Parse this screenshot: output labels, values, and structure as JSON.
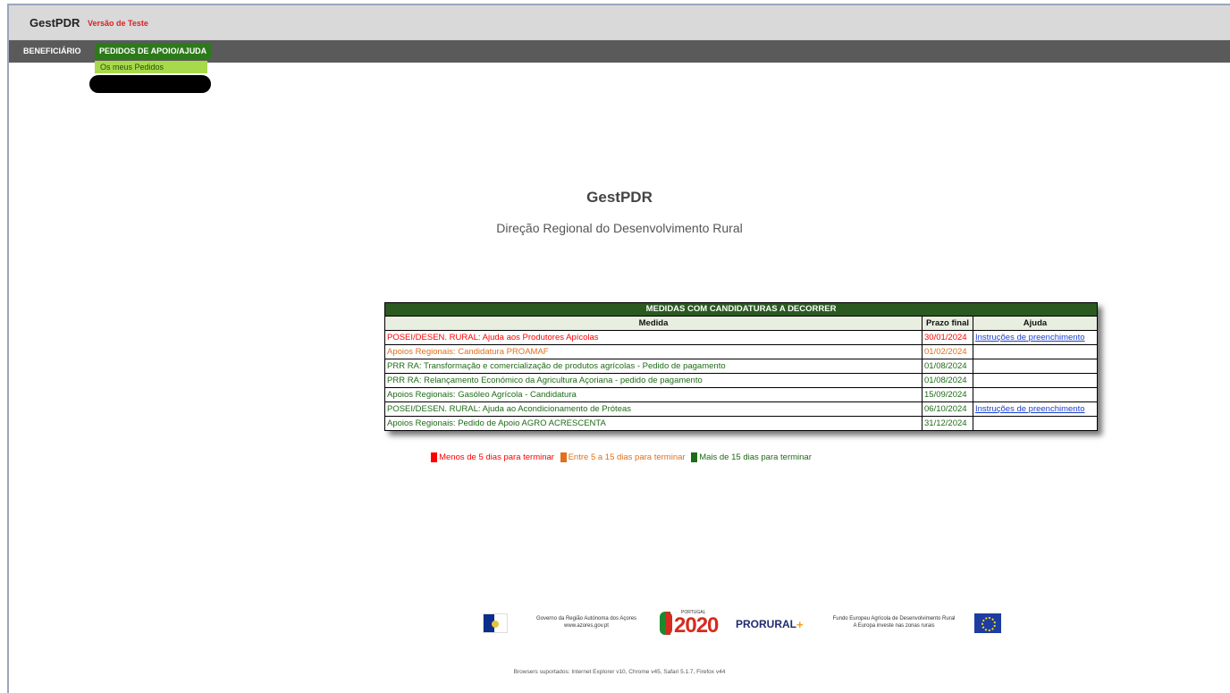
{
  "header": {
    "app_name": "GestPDR",
    "test_label": "Versão de Teste"
  },
  "menu": {
    "items": [
      {
        "label": "BENEFICIÁRIO",
        "active": false
      },
      {
        "label": "PEDIDOS DE APOIO/AJUDA",
        "active": true
      }
    ],
    "dropdown_item": "Os meus Pedidos"
  },
  "main": {
    "title": "GestPDR",
    "subtitle": "Direção Regional do Desenvolvimento Rural"
  },
  "table": {
    "caption": "MEDIDAS COM CANDIDATURAS A DECORRER",
    "headers": [
      "Medida",
      "Prazo final",
      "Ajuda"
    ],
    "rows": [
      {
        "medida": "POSEI/DESEN. RURAL: Ajuda aos Produtores Apícolas",
        "prazo": "30/01/2024",
        "ajuda": "Instruções de preenchimento",
        "status": "red"
      },
      {
        "medida": "Apoios Regionais: Candidatura PROAMAF",
        "prazo": "01/02/2024",
        "ajuda": "",
        "status": "orange"
      },
      {
        "medida": "PRR RA: Transformação e comercialização de produtos agrícolas - Pedido de pagamento",
        "prazo": "01/08/2024",
        "ajuda": "",
        "status": "green"
      },
      {
        "medida": "PRR RA: Relançamento Económico da Agricultura Açoriana - pedido de pagamento",
        "prazo": "01/08/2024",
        "ajuda": "",
        "status": "green"
      },
      {
        "medida": "Apoios Regionais: Gasóleo Agrícola - Candidatura",
        "prazo": "15/09/2024",
        "ajuda": "",
        "status": "green"
      },
      {
        "medida": "POSEI/DESEN. RURAL: Ajuda ao Acondicionamento de Próteas",
        "prazo": "06/10/2024",
        "ajuda": "Instruções de preenchimento",
        "status": "green"
      },
      {
        "medida": "Apoios Regionais: Pedido de Apoio AGRO ACRESCENTA",
        "prazo": "31/12/2024",
        "ajuda": "",
        "status": "green"
      }
    ]
  },
  "legend": {
    "red_label": "Menos de 5 dias para terminar",
    "orange_label": "Entre 5 a 15 dias para terminar",
    "green_label": "Mais de 15 dias para terminar",
    "colors": {
      "red": "#ff0000",
      "orange": "#e0701c",
      "green": "#1e6b16"
    }
  },
  "footer": {
    "gov_line1": "Governo da Região Autónoma dos Açores",
    "gov_line2": "www.azores.gov.pt",
    "portugal_small": "PORTUGAL",
    "portugal_2020": "2020",
    "prorural": "PRORURAL",
    "prorural_plus": "+",
    "feader_line1": "Fundo Europeu Agrícola de Desenvolvimento Rural",
    "feader_line2": "A Europa investe nas zonas rurais",
    "browsers": "Browsers suportados: Internet Explorer v10, Chrome v45, Safari 5.1.7, Firefox v44"
  }
}
